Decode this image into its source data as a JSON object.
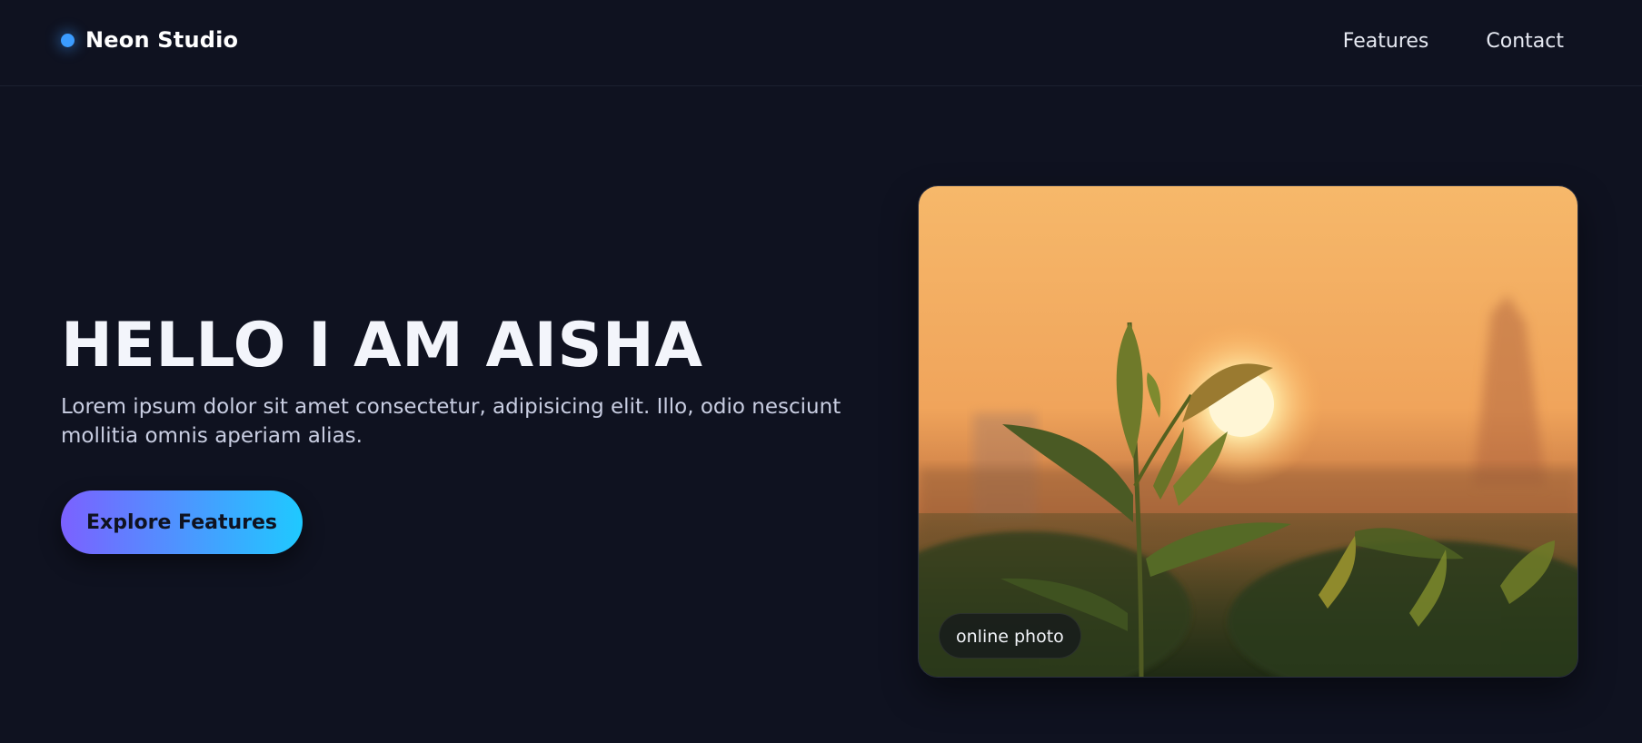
{
  "brand": {
    "name": "Neon Studio",
    "dot_color": "#3b9cff"
  },
  "nav": {
    "items": [
      "Features",
      "Contact"
    ]
  },
  "hero": {
    "title": "HELLO I AM AISHA",
    "subtitle": "Lorem ipsum dolor sit amet consectetur, adipisicing elit. Illo, odio nesciunt mollitia omnis aperiam alias.",
    "cta_label": "Explore Features",
    "cta_gradient": [
      "#7b61ff",
      "#1fc9ff"
    ]
  },
  "photo": {
    "badge": "online photo"
  },
  "colors": {
    "background": "#0f1220",
    "text": "#f3f5fb"
  }
}
